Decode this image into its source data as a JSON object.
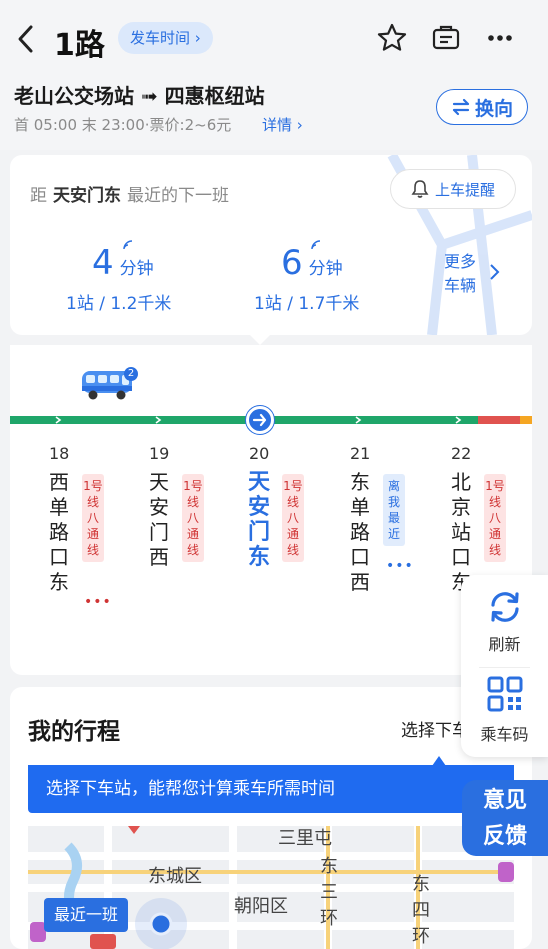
{
  "header": {
    "title": "1路",
    "schedule_label": "发车时间 ›",
    "route_name": "老山公交场站 ➟ 四惠枢纽站",
    "times": "首 05:00 末 23:00·票价:2~6元",
    "details_label": "详情 ›",
    "swap_label": "换向"
  },
  "next_bus": {
    "prefix": "距",
    "station": "天安门东",
    "suffix": "最近的下一班",
    "remind_label": "上车提醒",
    "etas": [
      {
        "minutes": "4",
        "unit": "分钟",
        "sub": "1站 / 1.2千米"
      },
      {
        "minutes": "6",
        "unit": "分钟",
        "sub": "1站 / 1.7千米"
      }
    ],
    "more_line1": "更多",
    "more_line2": "车辆"
  },
  "route_strip": {
    "bus_count": "2",
    "stops": [
      {
        "num": "18",
        "name": "西单路口东",
        "tag": "1号线八通线",
        "dots": "•••"
      },
      {
        "num": "19",
        "name": "天安门西",
        "tag": "1号线八通线",
        "dots": ""
      },
      {
        "num": "20",
        "name": "天安门东",
        "tag": "1号线八通线",
        "dots": ""
      },
      {
        "num": "21",
        "name": "东单路口西",
        "tag": "离我最近",
        "dots": "•••"
      },
      {
        "num": "22",
        "name": "北京站口东",
        "tag": "1号线八通线",
        "dots": ""
      }
    ]
  },
  "trip": {
    "title": "我的行程",
    "pick_alight": "选择下车站 ›",
    "banner": "选择下车站，能帮您计算乘车所需时间",
    "map_labels": [
      "三里屯",
      "东城区",
      "朝阳区",
      "东三环",
      "东四环"
    ],
    "latest_label": "最近一班"
  },
  "floating": {
    "refresh_label": "刷新",
    "ticket_label": "乘车码",
    "feedback_line1": "意见",
    "feedback_line2": "反馈"
  },
  "colors": {
    "accent": "#2a6fe0",
    "line_green": "#1fa66a",
    "line_red": "#e0534f",
    "line_orange": "#f5a623"
  }
}
